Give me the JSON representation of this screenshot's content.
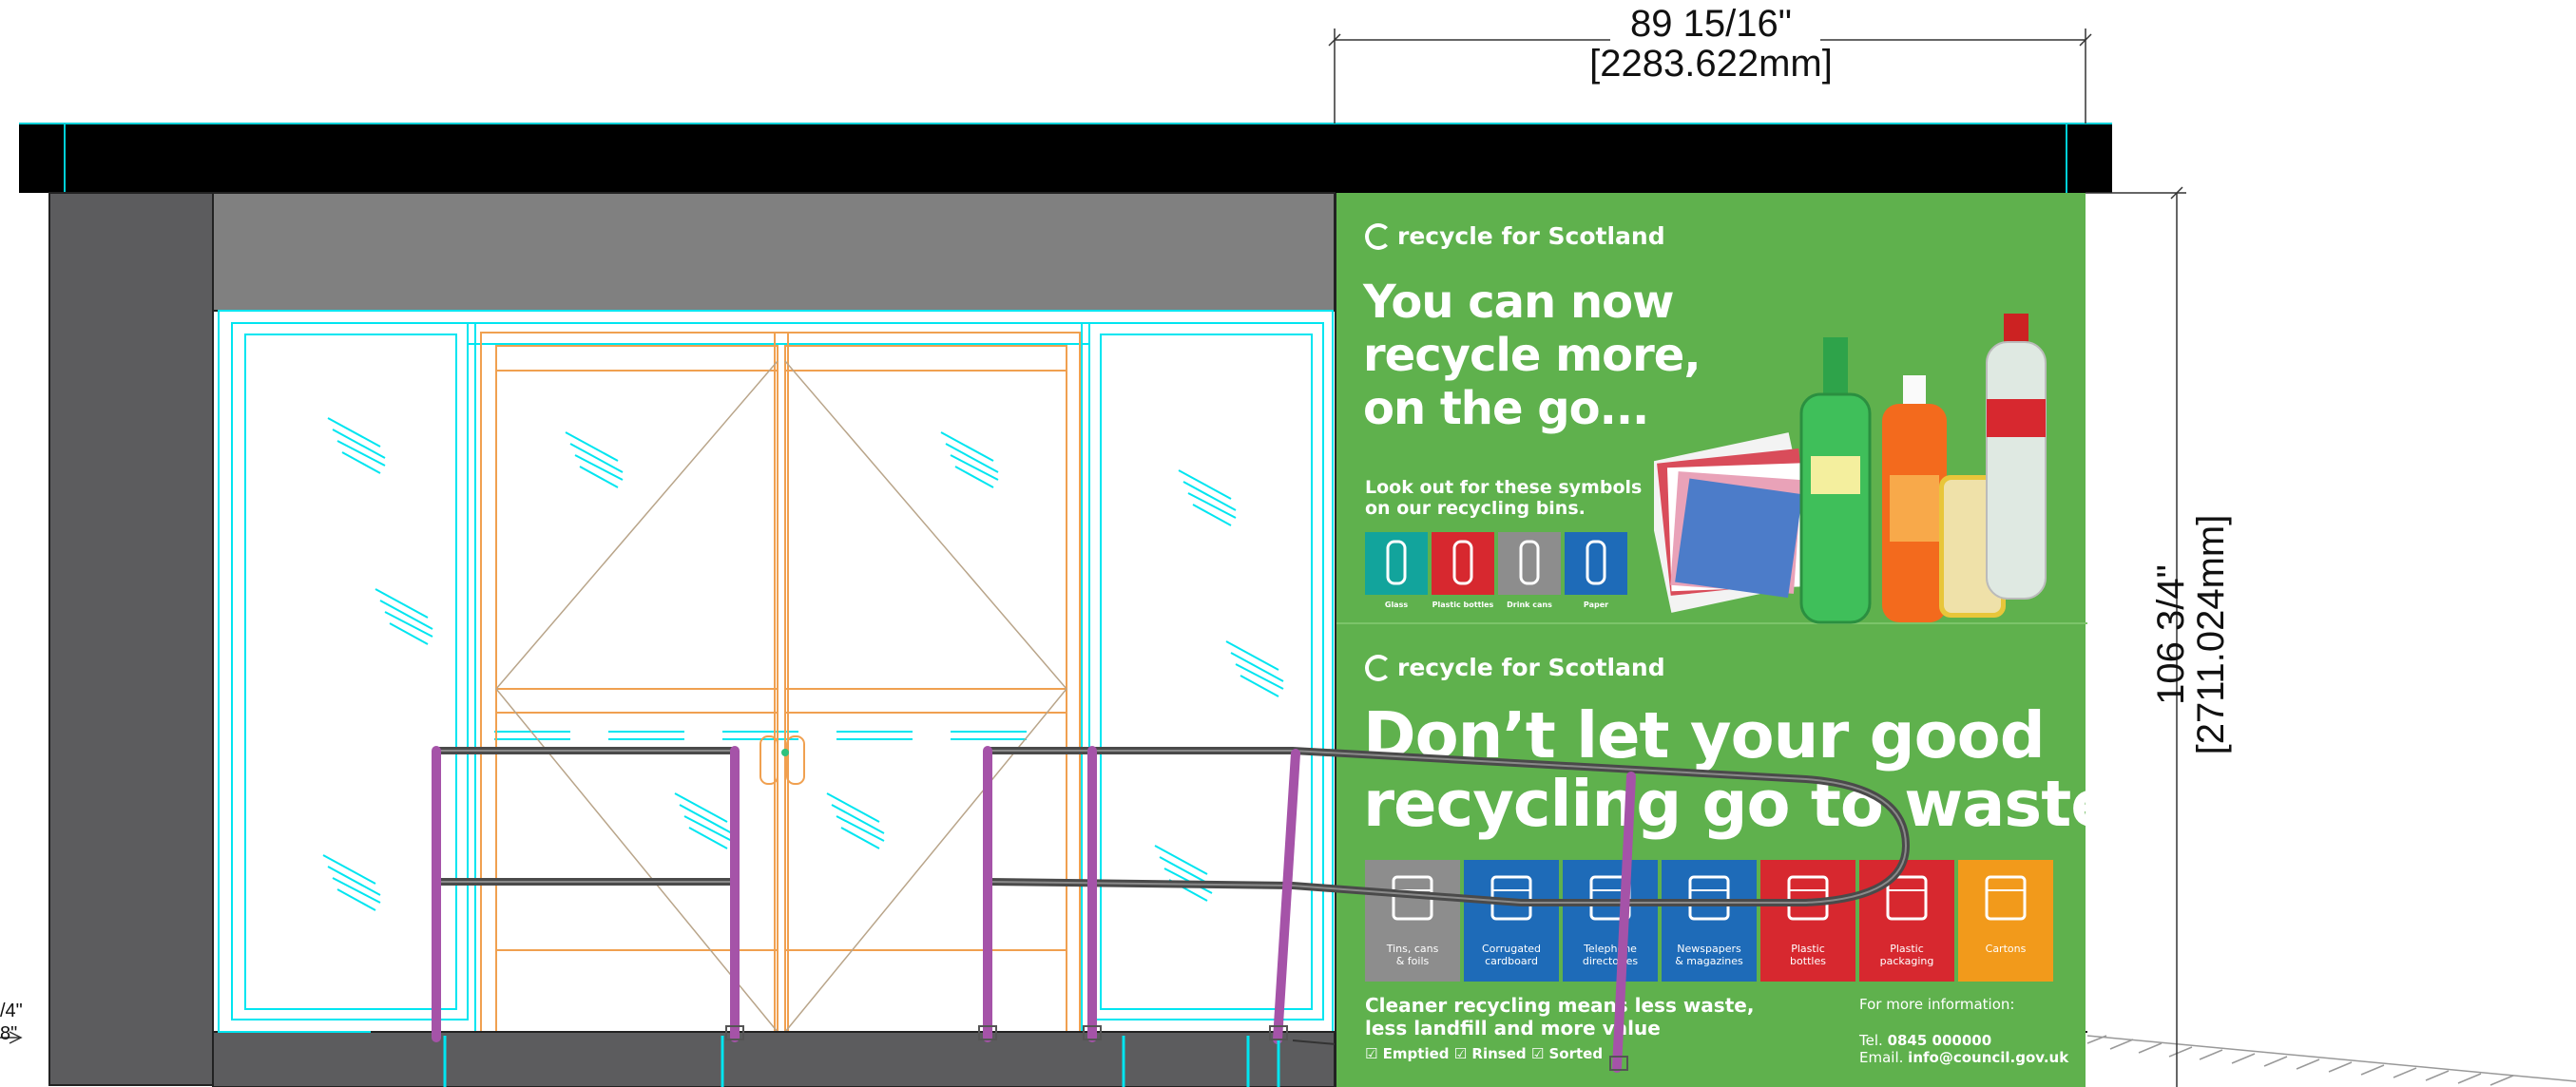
{
  "dimensions": {
    "width_primary": "89 15/16\"",
    "width_secondary": "[2283.622mm]",
    "height_primary": "106 3/4\"",
    "height_secondary": "[2711.024mm]",
    "left_cut_top": "/4\"",
    "left_cut_bottom": "8\""
  },
  "poster_top": {
    "logo": "recycle for Scotland",
    "headline_1": "You can now",
    "headline_2": "recycle more,",
    "headline_3": "on the go...",
    "sub_1": "Look out for these symbols",
    "sub_2": "on our recycling bins.",
    "symbols": [
      {
        "label": "Glass",
        "color": "#12a49c"
      },
      {
        "label": "Plastic bottles",
        "color": "#d7282f"
      },
      {
        "label": "Drink cans",
        "color": "#8d8d8d"
      },
      {
        "label": "Paper",
        "color": "#1e6bb8"
      }
    ]
  },
  "poster_bottom": {
    "logo": "recycle for Scotland",
    "headline_1": "Don’t let your good",
    "headline_2": "recycling go to waste",
    "categories": [
      {
        "line1": "Tins, cans",
        "line2": "& foils",
        "color": "#8d8d8d"
      },
      {
        "line1": "Corrugated",
        "line2": "cardboard",
        "color": "#1e6bb8"
      },
      {
        "line1": "Telephone",
        "line2": "directories",
        "color": "#1e6bb8"
      },
      {
        "line1": "Newspapers",
        "line2": "& magazines",
        "color": "#1e6bb8"
      },
      {
        "line1": "Plastic",
        "line2": "bottles",
        "color": "#d7282f"
      },
      {
        "line1": "Plastic",
        "line2": "packaging",
        "color": "#d7282f"
      },
      {
        "line1": "Cartons",
        "line2": "",
        "color": "#f29a1b"
      }
    ],
    "tagline_1": "Cleaner recycling means less waste,",
    "tagline_2": "less landfill and more value",
    "checks": "☑ Emptied ☑ Rinsed ☑ Sorted",
    "info_heading": "For more information:",
    "tel_label": "Tel.",
    "tel_value": "0845 000000",
    "email_label": "Email.",
    "email_value": "info@council.gov.uk"
  },
  "colors": {
    "poster_green": "#5fb14d",
    "canopy": "#000000",
    "wall_dark": "#5c5c5e",
    "wall_mid": "#808080",
    "glass_line": "#00e5f0",
    "door_line": "#f0a050",
    "rail_post": "#a553a8",
    "rail_bar": "#4a4a4a"
  }
}
